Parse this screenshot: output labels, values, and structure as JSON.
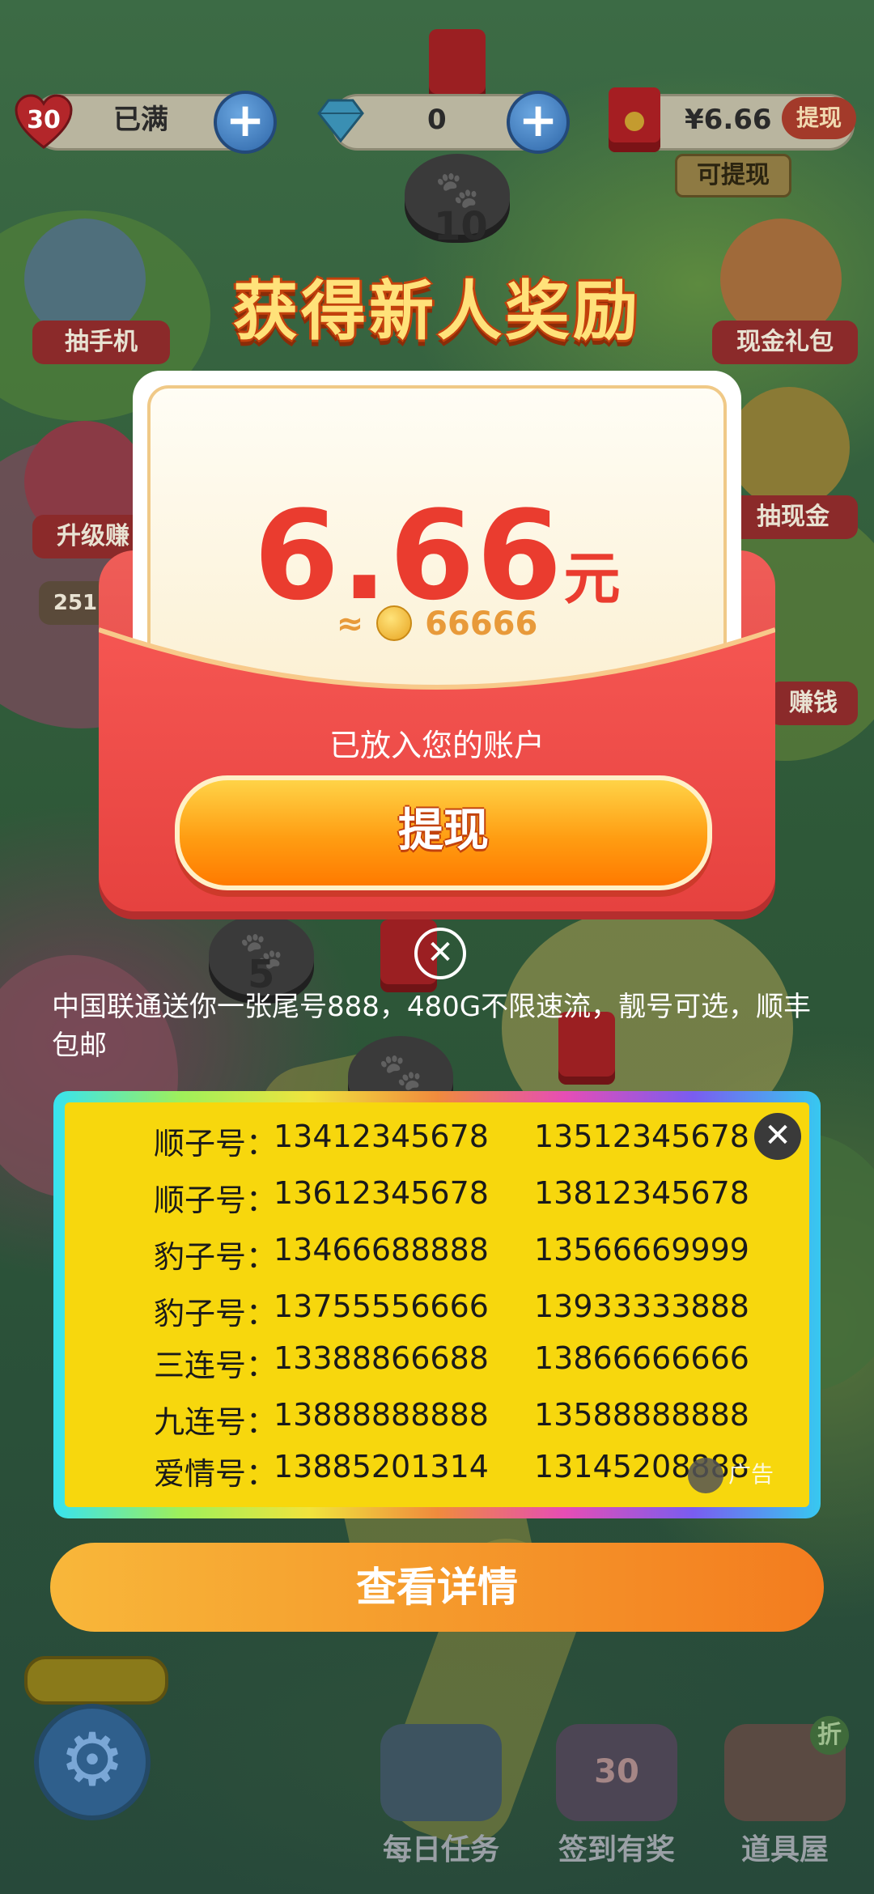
{
  "status_bar": {
    "lives_count": "30",
    "lives_status": "已满",
    "gem_count": "0",
    "balance": "¥6.66",
    "withdraw_label": "提现",
    "can_withdraw_label": "可提现"
  },
  "map": {
    "level_numbers": [
      "10",
      "5"
    ],
    "side_left": [
      "抽手机",
      "升级赚",
      "251"
    ],
    "side_right": [
      "现金礼包",
      "抽现金",
      "赚钱"
    ]
  },
  "popup": {
    "title": "获得新人奖励",
    "amount": "6.66",
    "amount_unit": "元",
    "approx_symbol": "≈",
    "coin_amount": "66666",
    "deposited_text": "已放入您的账户",
    "withdraw_button": "提现"
  },
  "ad": {
    "description": "中国联通送你一张尾号888，480G不限速流，靓号可选，顺丰包邮",
    "rows": [
      {
        "label": "顺子号：",
        "n1": "13412345678",
        "n2": "13512345678"
      },
      {
        "label": "顺子号：",
        "n1": "13612345678",
        "n2": "13812345678"
      },
      {
        "label": "豹子号：",
        "n1": "13466688888",
        "n2": "13566669999"
      },
      {
        "label": "豹子号：",
        "n1": "13755556666",
        "n2": "13933333888"
      },
      {
        "label": "三连号：",
        "n1": "13388866688",
        "n2": "13866666666"
      },
      {
        "label": "九连号：",
        "n1": "13888888888",
        "n2": "13588888888"
      },
      {
        "label": "爱情号：",
        "n1": "13885201314",
        "n2": "13145208888"
      }
    ],
    "badge": "广告",
    "detail_button": "查看详情"
  },
  "bottom_nav": {
    "daily_tasks": "每日任务",
    "checkin": "签到有奖",
    "checkin_badge": "30",
    "shop": "道具屋",
    "shop_badge": "折"
  },
  "colors": {
    "accent_red": "#ea3c2f",
    "button_orange": "#ff9d12",
    "ad_yellow": "#f7d70d"
  }
}
